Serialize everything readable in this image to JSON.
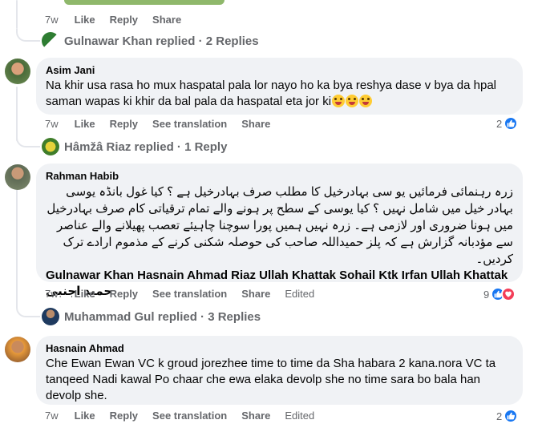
{
  "top_actions": {
    "time": "7w",
    "like": "Like",
    "reply": "Reply",
    "share": "Share"
  },
  "gulnawar_replied": {
    "name": "Gulnawar Khan",
    "replied": "replied",
    "sep": "·",
    "count": "2 Replies"
  },
  "comment1": {
    "author": "Asim Jani",
    "text": "Na khir usa rasa ho mux haspatal pala lor nayo ho ka bya reshya dase v bya da hpal saman wapas ki khir da bal pala da haspatal eta jor ki",
    "emoji_count": 3,
    "actions": {
      "time": "7w",
      "like": "Like",
      "reply": "Reply",
      "translate": "See translation",
      "share": "Share"
    },
    "reactions": "2"
  },
  "hamza_replied": {
    "name": "Hâmžâ Riaz",
    "replied": "replied",
    "sep": "·",
    "count": "1 Reply"
  },
  "comment2": {
    "author": "Rahman Habib",
    "urdu_text": "زرہ رہنمائی فرمائیں یو سی بہادرخیل کا مطلب صرف بہادرخیل ہے ؟ کیا غول بانڈہ یوسی بہادر خیل میں شامل نہیں ؟ کیا یوسی کے سطح پر ہونے والے تمام ترقیاتی کام صرف بہادرخیل میں ہونا ضروری اور لازمی ہے۔ زرہ نہیں ہمیں پورا سوچنا چاہیئے تعصب پھیلانے والے عناصر سے مؤدبانہ گزارش ہے کہ پلز حمیداللہ صاحب کی حوصلہ شکنی کرنے کے مذموم ارادے ترک کردیں۔",
    "tags": "Gulnawar Khan Hasnain Ahmad Riaz Ullah Khattak Sohail Ktk Irfan Ullah Khattak",
    "tag_last": "حمید اجنبی",
    "actions": {
      "time": "7w",
      "like": "Like",
      "reply": "Reply",
      "translate": "See translation",
      "share": "Share",
      "edited": "Edited"
    },
    "reactions": "9"
  },
  "gul_replied": {
    "name": "Muhammad Gul",
    "replied": "replied",
    "sep": "·",
    "count": "3 Replies"
  },
  "comment3": {
    "author": "Hasnain Ahmad",
    "text": "Che Ewan Ewan VC k groud jorezhee time to time da Sha habara 2 kana.nora VC ta tanqeed Nadi kawal Po chaar che ewa elaka devolp she no time sara bo bala han devolp she.",
    "actions": {
      "time": "7w",
      "like": "Like",
      "reply": "Reply",
      "translate": "See translation",
      "share": "Share",
      "edited": "Edited"
    },
    "reactions": "2"
  },
  "colors": {
    "accent": "#1877f2",
    "love": "#f33e58",
    "bubble": "#f0f2f5",
    "muted": "#65676b"
  }
}
